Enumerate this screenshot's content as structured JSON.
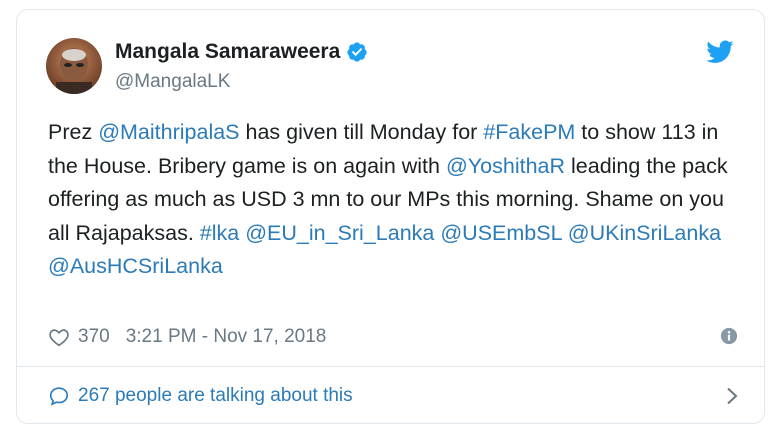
{
  "author": {
    "name": "Mangala Samaraweera",
    "handle": "@MangalaLK"
  },
  "tweet": {
    "segments": [
      {
        "text": "Prez ",
        "type": "text"
      },
      {
        "text": "@MaithripalaS",
        "type": "mention"
      },
      {
        "text": " has given till Monday for ",
        "type": "text"
      },
      {
        "text": "#FakePM",
        "type": "hashtag"
      },
      {
        "text": " to show 113 in the House. Bribery game is on again with ",
        "type": "text"
      },
      {
        "text": "@YoshithaR",
        "type": "mention"
      },
      {
        "text": " leading the pack offering as much as USD 3 mn to our MPs this morning. Shame on you all Rajapaksas. ",
        "type": "text"
      },
      {
        "text": "#lka",
        "type": "hashtag"
      },
      {
        "text": " ",
        "type": "text"
      },
      {
        "text": "@EU_in_Sri_Lanka",
        "type": "mention"
      },
      {
        "text": " ",
        "type": "text"
      },
      {
        "text": "@USEmbSL",
        "type": "mention"
      },
      {
        "text": " ",
        "type": "text"
      },
      {
        "text": "@UKinSriLanka",
        "type": "mention"
      },
      {
        "text": " ",
        "type": "text"
      },
      {
        "text": "@AusHCSriLanka",
        "type": "mention"
      }
    ]
  },
  "meta": {
    "likes": "370",
    "timestamp": "3:21 PM - Nov 17, 2018"
  },
  "footer": {
    "conversation_label": "267 people are talking about this"
  },
  "colors": {
    "link": "#2b7bb9",
    "text": "#1c2022",
    "muted": "#697882",
    "verified": "#1da1f2",
    "twitter_blue": "#1da1f2"
  },
  "icons": {
    "verified": "verified-badge-icon",
    "logo": "twitter-bird-icon",
    "heart": "heart-icon",
    "info": "info-icon",
    "bubble": "speech-bubble-icon",
    "chevron": "chevron-right-icon"
  }
}
